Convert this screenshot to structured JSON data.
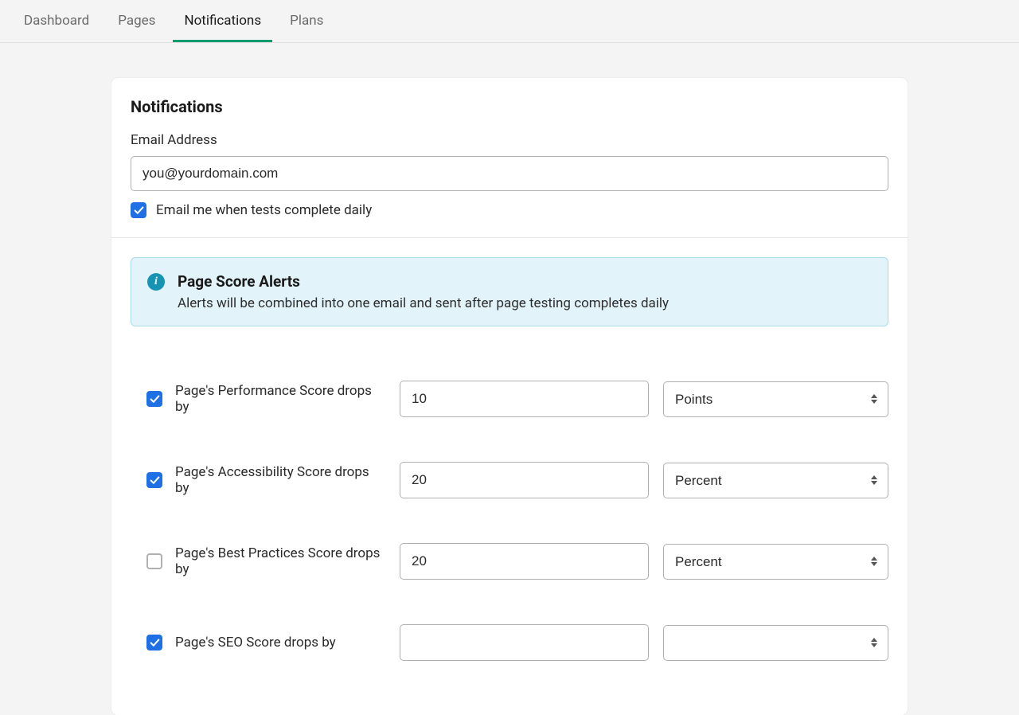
{
  "tabs": {
    "items": [
      "Dashboard",
      "Pages",
      "Notifications",
      "Plans"
    ],
    "active_index": 2
  },
  "notifications": {
    "title": "Notifications",
    "email_label": "Email Address",
    "email_placeholder": "you@yourdomain.com",
    "daily_checked": true,
    "daily_label": "Email me when tests complete daily"
  },
  "banner": {
    "title": "Page Score Alerts",
    "desc": "Alerts will be combined into one email and sent after page testing completes daily"
  },
  "select_options": [
    "Points",
    "Percent"
  ],
  "alerts": [
    {
      "checked": true,
      "label": "Page's Performance Score drops by",
      "value": "10",
      "unit": "Points"
    },
    {
      "checked": true,
      "label": "Page's Accessibility Score drops by",
      "value": "20",
      "unit": "Percent"
    },
    {
      "checked": false,
      "label": "Page's Best Practices Score drops by",
      "value": "20",
      "unit": "Percent"
    },
    {
      "checked": true,
      "label": "Page's SEO Score drops by",
      "value": "",
      "unit": ""
    }
  ]
}
